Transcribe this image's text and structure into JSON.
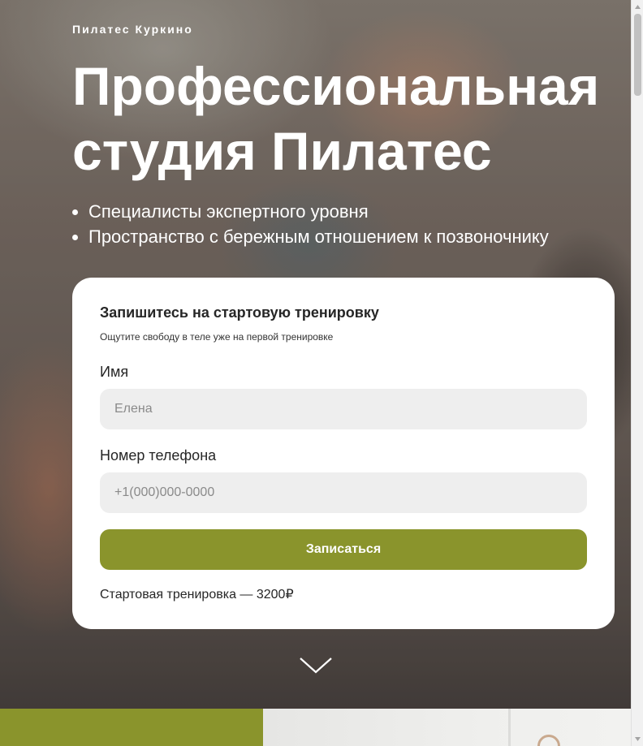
{
  "brand": "Пилатес Куркино",
  "headline": "Профессиональная студия Пилатес",
  "bullets": [
    "Специалисты экспертного уровня",
    "Пространство с бережным отношением к позвоночнику"
  ],
  "form": {
    "title": "Запишитесь на стартовую тренировку",
    "subtitle": "Ощутите свободу в теле уже на первой тренировке",
    "name_label": "Имя",
    "name_placeholder": "Елена",
    "phone_label": "Номер телефона",
    "phone_placeholder": "+1(000)000-0000",
    "submit_label": "Записаться",
    "price_note": "Стартовая тренировка — 3200₽"
  },
  "icons": {
    "scroll_down": "chevron-down-icon"
  },
  "colors": {
    "accent": "#8a942c",
    "card_bg": "#ffffff",
    "field_bg": "#eeeeee"
  }
}
